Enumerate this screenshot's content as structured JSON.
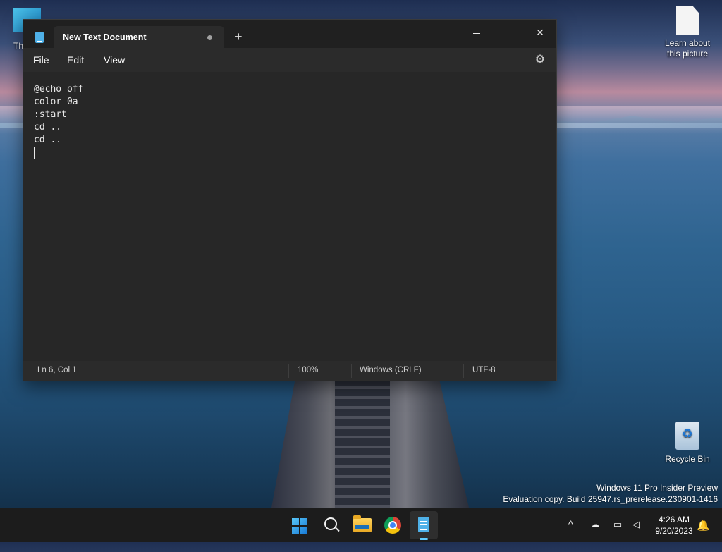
{
  "desktop": {
    "icons": {
      "this_pc_label": "Th",
      "learn_label": "Learn about this picture",
      "recycle_label": "Recycle Bin"
    },
    "watermark": {
      "line1": "Windows 11 Pro Insider Preview",
      "line2": "Evaluation copy. Build 25947.rs_prerelease.230901-1416"
    }
  },
  "notepad": {
    "tab_title": "New Text Document",
    "new_tab_glyph": "+",
    "close_glyph": "✕",
    "menu": {
      "file": "File",
      "edit": "Edit",
      "view": "View"
    },
    "settings_glyph": "⚙",
    "content": "@echo off\ncolor 0a\n:start\ncd ..\ncd ..",
    "status": {
      "position": "Ln 6, Col 1",
      "zoom": "100%",
      "line_ending": "Windows (CRLF)",
      "encoding": "UTF-8"
    }
  },
  "taskbar": {
    "apps": [
      "start",
      "search",
      "file-explorer",
      "chrome",
      "notepad"
    ],
    "active_app": "notepad",
    "tray": {
      "chevron": "^",
      "time": "4:26 AM",
      "date": "9/20/2023"
    }
  },
  "colors": {
    "accent": "#60cdff",
    "window_bg": "#202020",
    "editor_bg": "#272727"
  }
}
